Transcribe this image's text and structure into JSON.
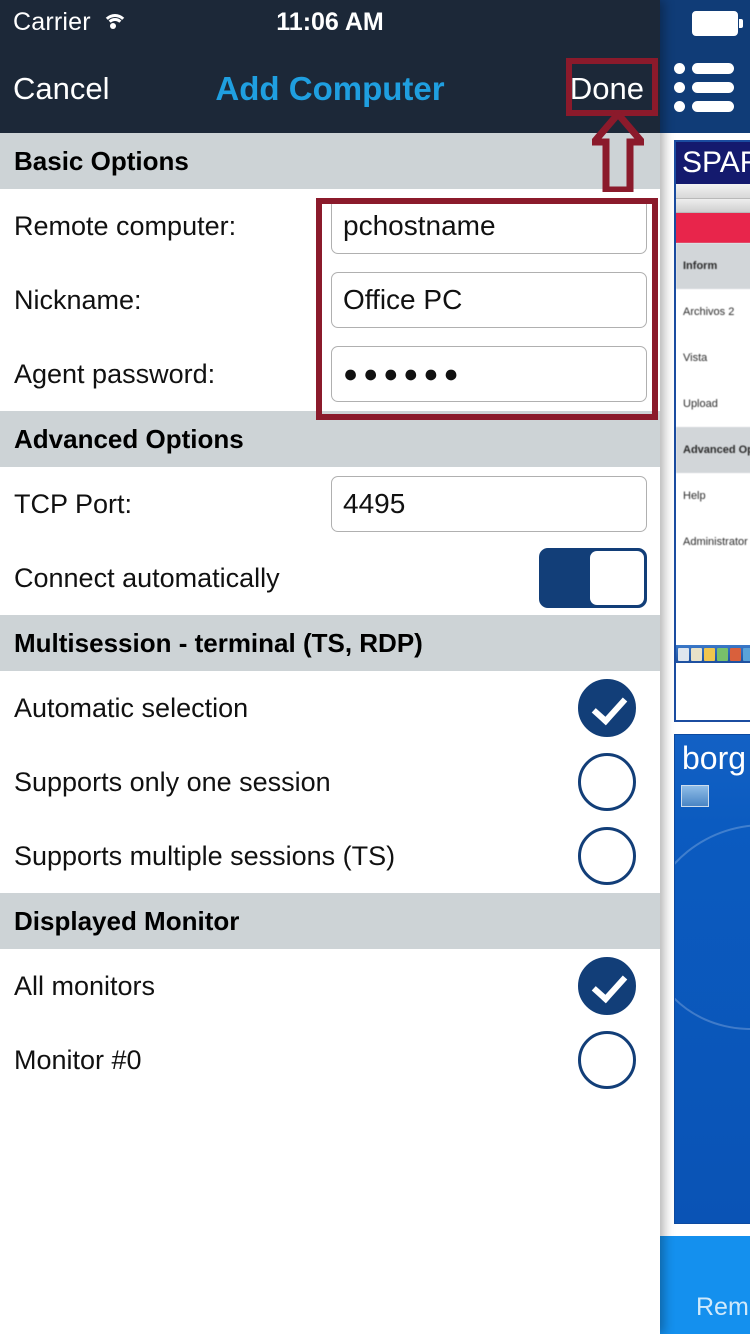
{
  "status_bar": {
    "carrier": "Carrier",
    "wifi_icon": "wifi-icon",
    "time": "11:06 AM",
    "battery_icon": "battery-icon"
  },
  "nav_bar": {
    "cancel_label": "Cancel",
    "title": "Add Computer",
    "done_label": "Done"
  },
  "sections": {
    "basic": {
      "header": "Basic Options",
      "rows": [
        {
          "label": "Remote computer:",
          "value": "pchostname",
          "type": "text"
        },
        {
          "label": "Nickname:",
          "value": "Office PC",
          "type": "text"
        },
        {
          "label": "Agent password:",
          "value": "●●●●●●",
          "type": "password"
        }
      ]
    },
    "advanced": {
      "header": "Advanced Options",
      "tcp_port_label": "TCP Port:",
      "tcp_port_value": "4495",
      "connect_auto_label": "Connect automatically",
      "connect_auto_state": "on"
    },
    "multisession": {
      "header": "Multisession - terminal (TS, RDP)",
      "options": [
        {
          "label": "Automatic selection",
          "selected": true
        },
        {
          "label": "Supports only one session",
          "selected": false
        },
        {
          "label": "Supports multiple sessions (TS)",
          "selected": false
        }
      ]
    },
    "monitor": {
      "header": "Displayed Monitor",
      "options": [
        {
          "label": "All monitors",
          "selected": true
        },
        {
          "label": "Monitor #0",
          "selected": false
        }
      ]
    }
  },
  "annotations": {
    "color": "#8B1A2B",
    "done_highlight": "rectangle around Done button",
    "fields_highlight": "rectangle around Basic Options input fields",
    "arrow": "up-arrow pointing at Done button"
  },
  "background_app": {
    "spar_card_title": "SPAR",
    "spar_rows": [
      "Inform",
      "Archivos 2",
      "Vista",
      "Upload",
      "Advanced Options",
      "Help",
      "Administrator"
    ],
    "borg_card_title": "borg",
    "remote_card_label": "Rem"
  },
  "colors": {
    "navbar_bg": "#1C2838",
    "title_accent": "#1F9FE0",
    "section_header_bg": "#CDD3D6",
    "control_blue": "#123E78",
    "annotation_red": "#8B1A2B",
    "bg_app_blue": "#103C77",
    "remote_blue": "#1490EE"
  }
}
